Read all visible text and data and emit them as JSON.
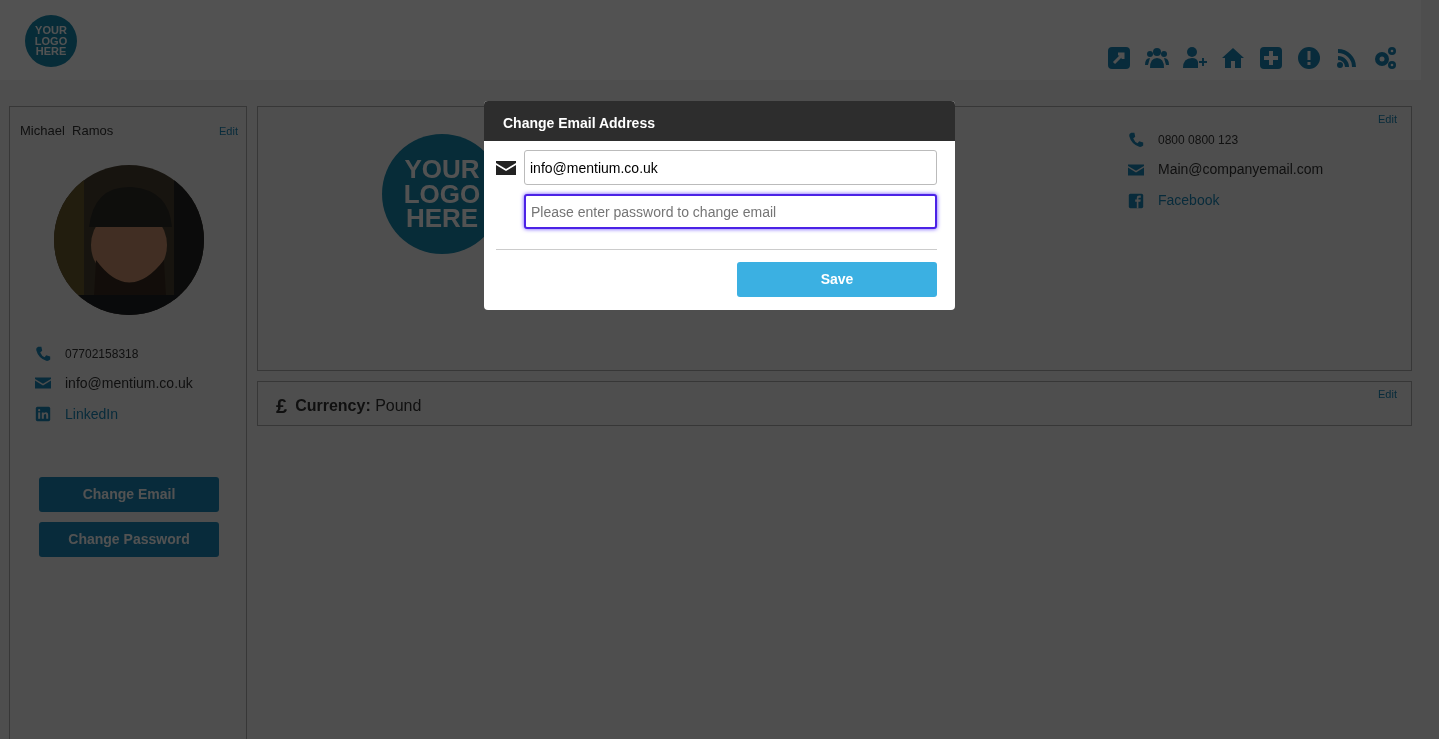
{
  "header": {
    "logo": {
      "lines": [
        "YOUR",
        "LOGO",
        "HERE"
      ]
    }
  },
  "profile": {
    "first_name": "Michael",
    "last_name": "Ramos",
    "edit": "Edit",
    "phone": "07702158318",
    "email": "info@mentium.co.uk",
    "linkedin": "LinkedIn",
    "buttons": [
      "Change Email",
      "Change Password"
    ]
  },
  "company": {
    "logo": {
      "lines": [
        "YOUR",
        "LOGO",
        "HERE"
      ]
    },
    "edit": "Edit",
    "phone": "0800 0800 123",
    "email": "Main@companyemail.com",
    "facebook": "Facebook"
  },
  "currency": {
    "symbol": "£",
    "label": "Currency:",
    "value": "Pound",
    "edit": "Edit"
  },
  "modal": {
    "title": "Change Email Address",
    "email": {
      "value": "info@mentium.co.uk"
    },
    "password": {
      "placeholder": "Please enter password to change email",
      "focused": true
    },
    "save": "Save"
  }
}
